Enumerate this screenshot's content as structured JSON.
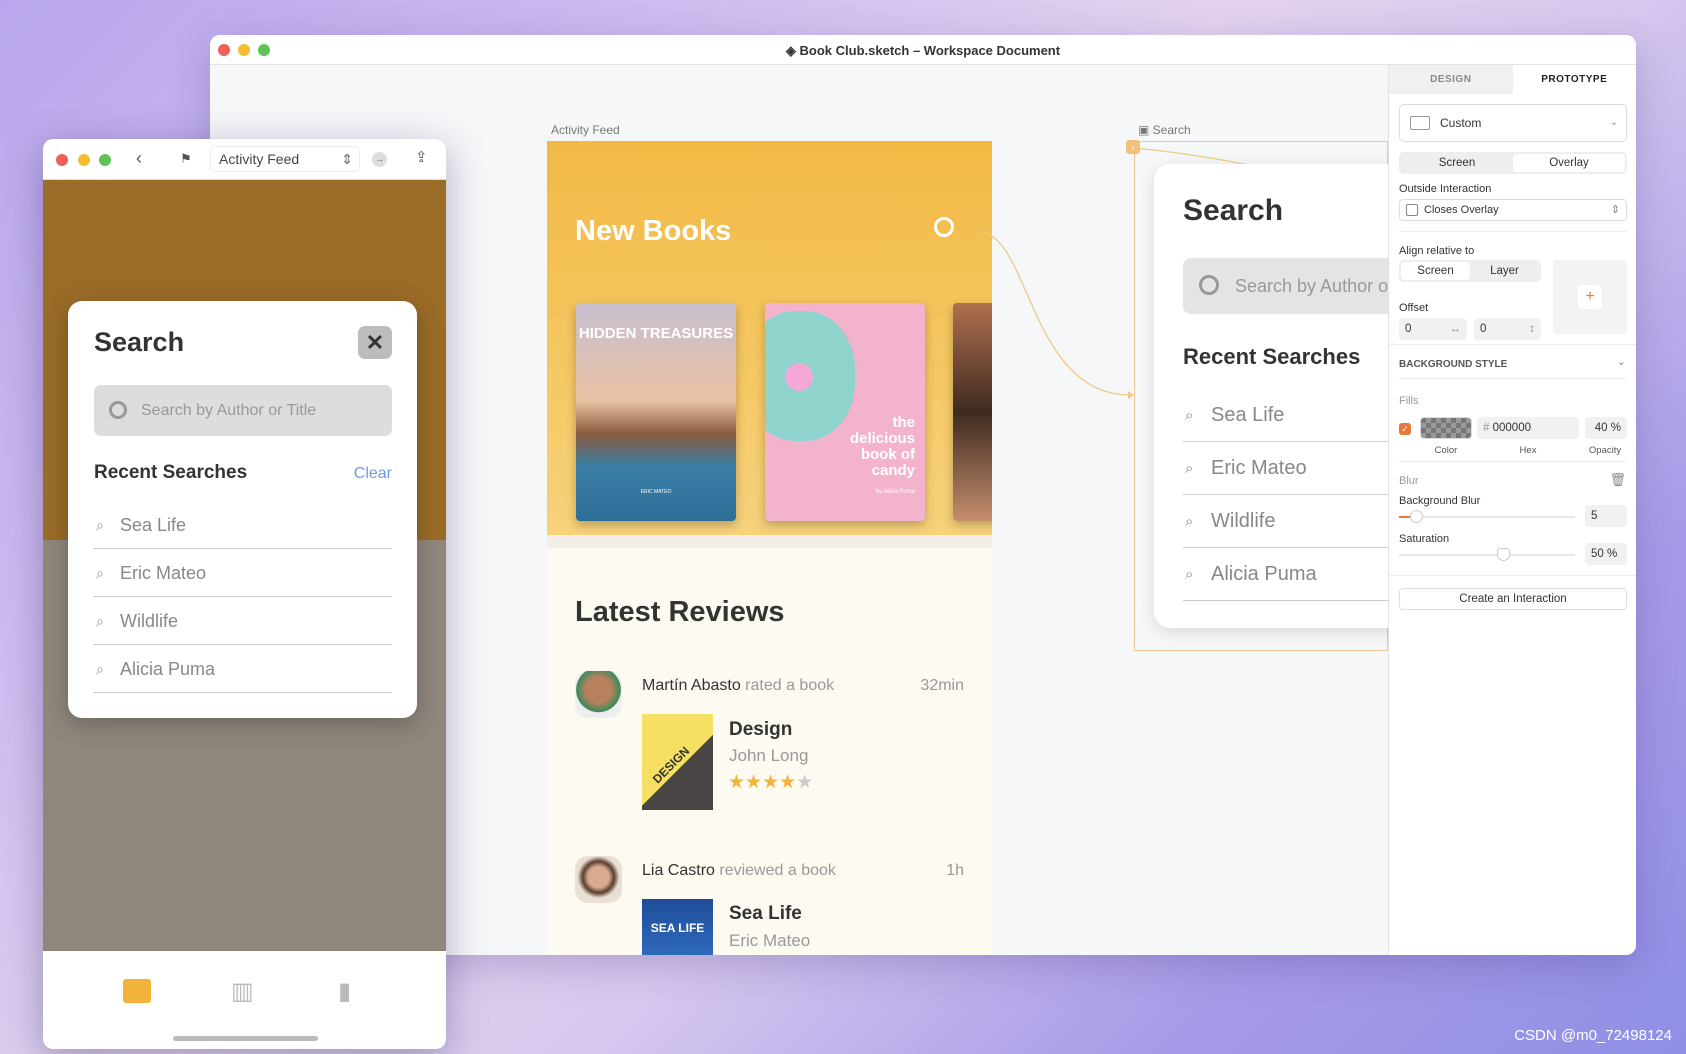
{
  "window": {
    "title": "Book Club.sketch – Workspace Document"
  },
  "artboards": {
    "feed_label": "Activity Feed",
    "search_label": "Search"
  },
  "feed": {
    "header_title": "New Books",
    "books": [
      {
        "title": "HIDDEN TREASURES",
        "author": "ERIC MATEO"
      },
      {
        "title": "the delicious book of candy",
        "author": "by Alicia Puma"
      }
    ],
    "reviews_title": "Latest Reviews",
    "reviews": [
      {
        "user": "Martín Abasto",
        "action": "rated a book",
        "time": "32min",
        "book": "Design",
        "author": "John Long",
        "cover_text": "DESIGN",
        "rating": 4,
        "max_rating": 5
      },
      {
        "user": "Lia Castro",
        "action": "reviewed a book",
        "time": "1h",
        "book": "Sea Life",
        "author": "Eric Mateo",
        "cover_text": "SEA LIFE"
      }
    ]
  },
  "search_artboard": {
    "title": "Search",
    "placeholder": "Search by Author or Title",
    "recent_title": "Recent Searches",
    "items": [
      "Sea Life",
      "Eric Mateo",
      "Wildlife",
      "Alicia Puma"
    ]
  },
  "panel": {
    "tabs": [
      "DESIGN",
      "PROTOTYPE"
    ],
    "active_tab": "PROTOTYPE",
    "device": "Custom",
    "mode": [
      "Screen",
      "Overlay"
    ],
    "active_mode": "Overlay",
    "outside_label": "Outside Interaction",
    "outside_value": "Closes Overlay",
    "align_label": "Align relative to",
    "align": [
      "Screen",
      "Layer"
    ],
    "active_align": "Screen",
    "offset_label": "Offset",
    "offset_x": "0",
    "offset_y": "0",
    "bg_style": "BACKGROUND STYLE",
    "fills": "Fills",
    "hex_prefix": "#",
    "hex": "000000",
    "opacity": "40",
    "pct": "%",
    "color_label": "Color",
    "hex_label": "Hex",
    "opacity_label": "Opacity",
    "blur": "Blur",
    "bg_blur_label": "Background Blur",
    "bg_blur": "5",
    "bg_blur_fraction": 0.05,
    "saturation_label": "Saturation",
    "saturation": "50",
    "saturation_fraction": 0.5,
    "create": "Create an Interaction",
    "accent": "#e8783a"
  },
  "preview": {
    "page": "Activity Feed",
    "modal_title": "Search",
    "placeholder": "Search by Author or Title",
    "recent_title": "Recent Searches",
    "clear": "Clear",
    "items": [
      "Sea Life",
      "Eric Mateo",
      "Wildlife",
      "Alicia Puma"
    ]
  },
  "watermark": "CSDN @m0_72498124"
}
